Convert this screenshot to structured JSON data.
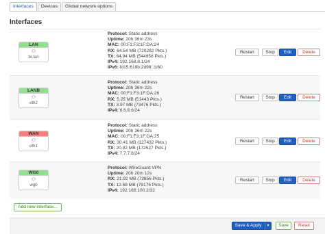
{
  "tabs": [
    {
      "label": "Interfaces",
      "active": true
    },
    {
      "label": "Devices",
      "active": false
    },
    {
      "label": "Global network options",
      "active": false
    }
  ],
  "heading": "Interfaces",
  "interfaces": [
    {
      "name": "LAN",
      "device": "br-lan",
      "color": "#90e090",
      "lines": [
        {
          "k": "Protocol:",
          "v": "Static address"
        },
        {
          "k": "Uptime:",
          "v": "20h 36m 23s"
        },
        {
          "k": "MAC:",
          "v": "00:F1:F3:1F:DA:24"
        },
        {
          "k": "RX:",
          "v": "64.54 MB (720282 Pkts.)"
        },
        {
          "k": "TX:",
          "v": "64.94 MB (544958 Pkts.)"
        },
        {
          "k": "IPv4:",
          "v": "192.168.8.1/24"
        },
        {
          "k": "IPv6:",
          "v": "fd15:619b:2d98::1/60"
        }
      ]
    },
    {
      "name": "LANB",
      "device": "eth2",
      "color": "#90e090",
      "lines": [
        {
          "k": "Protocol:",
          "v": "Static address"
        },
        {
          "k": "Uptime:",
          "v": "20h 36m 22s"
        },
        {
          "k": "MAC:",
          "v": "00:F1:F3:1F:DA:26"
        },
        {
          "k": "RX:",
          "v": "5.25 MB (51443 Pkts.)"
        },
        {
          "k": "TX:",
          "v": "3.97 MB (73476 Pkts.)"
        },
        {
          "k": "IPv4:",
          "v": "6.6.6.6/24"
        }
      ]
    },
    {
      "name": "WAN",
      "device": "eth1",
      "color": "#f08080",
      "lines": [
        {
          "k": "Protocol:",
          "v": "Static address"
        },
        {
          "k": "Uptime:",
          "v": "20h 36m 22s"
        },
        {
          "k": "MAC:",
          "v": "00:F1:F3:1F:DA:25"
        },
        {
          "k": "RX:",
          "v": "30.41 MB (127432 Pkts.)"
        },
        {
          "k": "TX:",
          "v": "20.92 MB (172527 Pkts.)"
        },
        {
          "k": "IPv4:",
          "v": "7.7.7.8/24"
        }
      ]
    },
    {
      "name": "WG0",
      "device": "wg0",
      "color": "#90e090",
      "lines": [
        {
          "k": "Protocol:",
          "v": "WireGuard VPN"
        },
        {
          "k": "Uptime:",
          "v": "20h 20m 12s"
        },
        {
          "k": "RX:",
          "v": "21.92 MB (73856 Pkts.)"
        },
        {
          "k": "TX:",
          "v": "12.68 MB (79175 Pkts.)"
        },
        {
          "k": "IPv4:",
          "v": "192.168.100.2/32"
        }
      ]
    }
  ],
  "row_buttons": {
    "restart": "Restart",
    "stop": "Stop",
    "edit": "Edit",
    "delete": "Delete"
  },
  "add_interface": "Add new interface...",
  "footer": {
    "save_apply": "Save & Apply",
    "dropdown": "▾",
    "save": "Save",
    "reset": "Reset"
  },
  "icons": {
    "device": "network-port-icon"
  }
}
